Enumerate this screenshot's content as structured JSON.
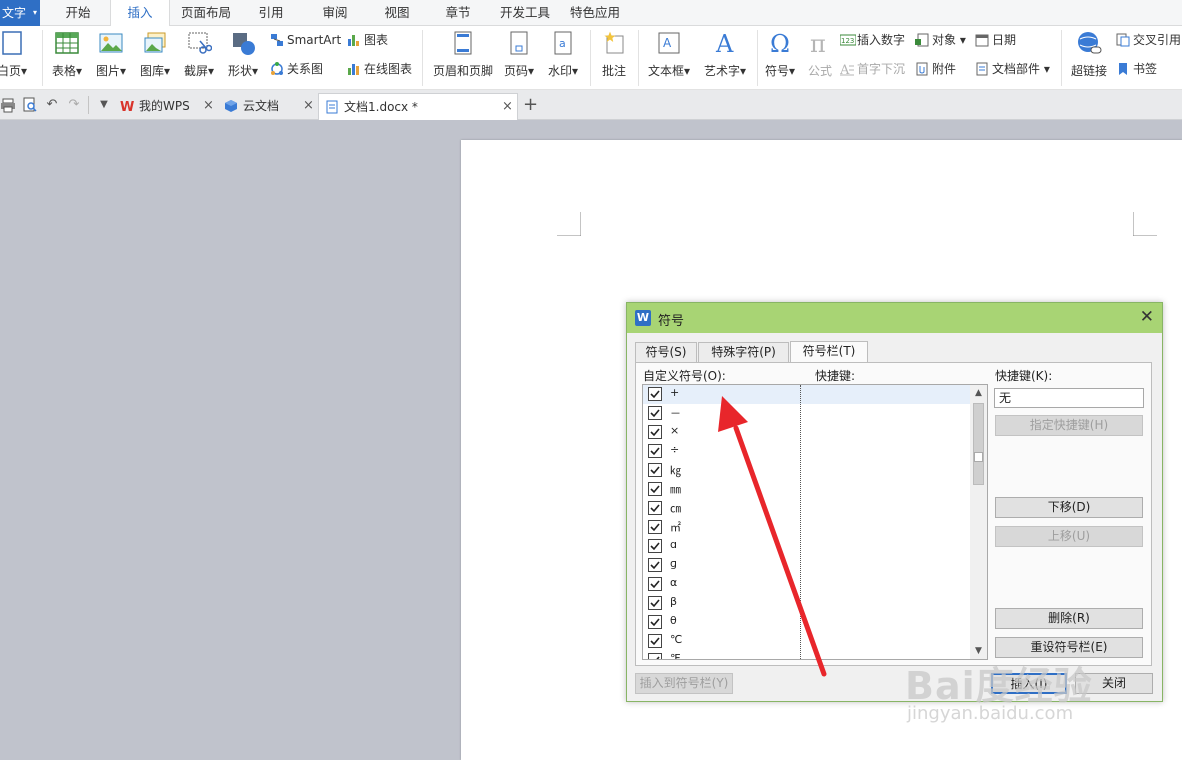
{
  "app": {
    "name": "文字"
  },
  "menu_tabs": [
    "开始",
    "插入",
    "页面布局",
    "引用",
    "审阅",
    "视图",
    "章节",
    "开发工具",
    "特色应用"
  ],
  "menu_active": "插入",
  "ribbon": {
    "page": "白页",
    "table": "表格",
    "picture": "图片",
    "gallery": "图库",
    "screenshot": "截屏",
    "shape": "形状",
    "smartart": "SmartArt",
    "chart": "图表",
    "relation": "关系图",
    "online_chart": "在线图表",
    "header_footer": "页眉和页脚",
    "page_number": "页码",
    "watermark": "水印",
    "comment": "批注",
    "textbox": "文本框",
    "wordart": "艺术字",
    "symbol": "符号",
    "formula": "公式",
    "insert_number": "插入数字",
    "drop_cap": "首字下沉",
    "object": "对象",
    "attachment": "附件",
    "date": "日期",
    "doc_parts": "文档部件",
    "hyperlink": "超链接",
    "cross_ref": "交叉引用",
    "bookmark": "书签"
  },
  "doc_tabs": [
    {
      "label": "我的WPS"
    },
    {
      "label": "云文档"
    },
    {
      "label": "文档1.docx *"
    }
  ],
  "dialog": {
    "title": "符号",
    "tabs": [
      "符号(S)",
      "特殊字符(P)",
      "符号栏(T)"
    ],
    "active_tab": "符号栏(T)",
    "list_label": "自定义符号(O):",
    "hotkey_col_label": "快捷键:",
    "hotkey_field_label": "快捷键(K):",
    "hotkey_value": "无",
    "symbols": [
      "+",
      "－",
      "×",
      "÷",
      "㎏",
      "㎜",
      "㎝",
      "㎡",
      "ɑ",
      "ɡ",
      "α",
      "β",
      "θ",
      "℃",
      "℉"
    ],
    "buttons": {
      "assign_hotkey": "指定快捷键(H)",
      "move_down": "下移(D)",
      "move_up": "上移(U)",
      "delete": "删除(R)",
      "reset": "重设符号栏(E)",
      "insert_to_bar": "插入到符号栏(Y)",
      "insert": "插入(I)",
      "close": "关闭"
    }
  },
  "watermark": {
    "main": "Bai度经验",
    "sub": "jingyan.baidu.com"
  },
  "colors": {
    "accent": "#2f6fc5",
    "dialog_title": "#a8d474",
    "arrow": "#e8262b"
  }
}
